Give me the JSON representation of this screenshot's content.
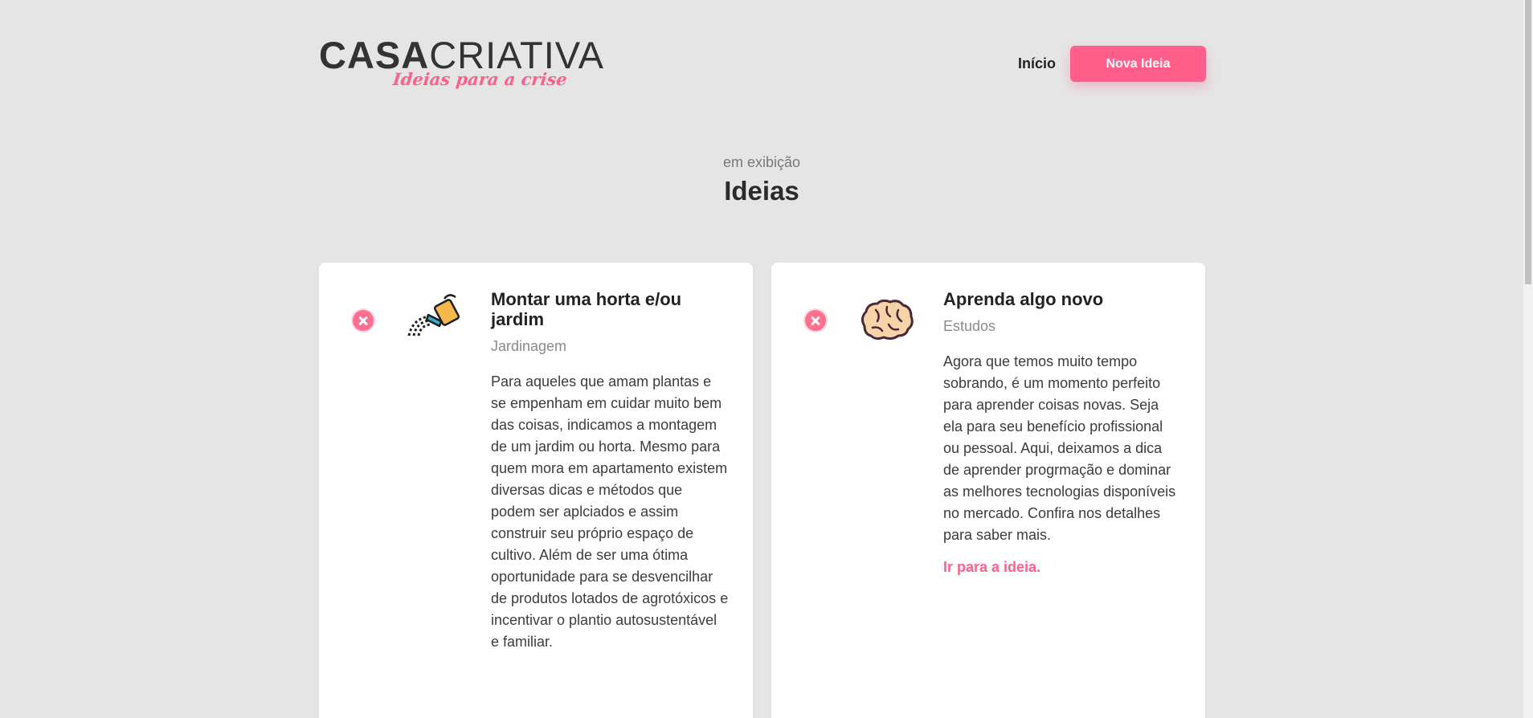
{
  "header": {
    "logo_primary_bold": "CASA",
    "logo_primary_light": "CRIATIVA",
    "logo_tagline": "Ideias para a crise",
    "nav": {
      "home_label": "Início",
      "new_idea_label": "Nova Ideia"
    }
  },
  "section": {
    "subtitle": "em exibição",
    "title": "Ideias"
  },
  "ideas": [
    {
      "title": "Montar uma horta e/ou jardim",
      "category": "Jardinagem",
      "icon": "watering-can-icon",
      "description": "Para aqueles que amam plantas e se empenham em cuidar muito bem das coisas, indicamos a montagem de um jardim ou horta. Mesmo para quem mora em apartamento existem diversas dicas e métodos que podem ser aplciados e assim construir seu próprio espaço de cultivo. Além de ser uma ótima oportunidade para se desvencilhar de produtos lotados de agrotóxicos e incentivar o plantio autosustentável e familiar.",
      "link_label": ""
    },
    {
      "title": "Aprenda algo novo",
      "category": "Estudos",
      "icon": "brain-icon",
      "description": "Agora que temos muito tempo sobrando, é um momento perfeito para aprender coisas novas. Seja ela para seu benefício profissional ou pessoal. Aqui, deixamos a dica de aprender progrmação e dominar as melhores tecnologias disponíveis no mercado. Confira nos detalhes para saber mais.",
      "link_label": "Ir para a ideia."
    }
  ],
  "colors": {
    "accent": "#ff5f8a",
    "background": "#e5e5e5",
    "card": "#ffffff"
  }
}
